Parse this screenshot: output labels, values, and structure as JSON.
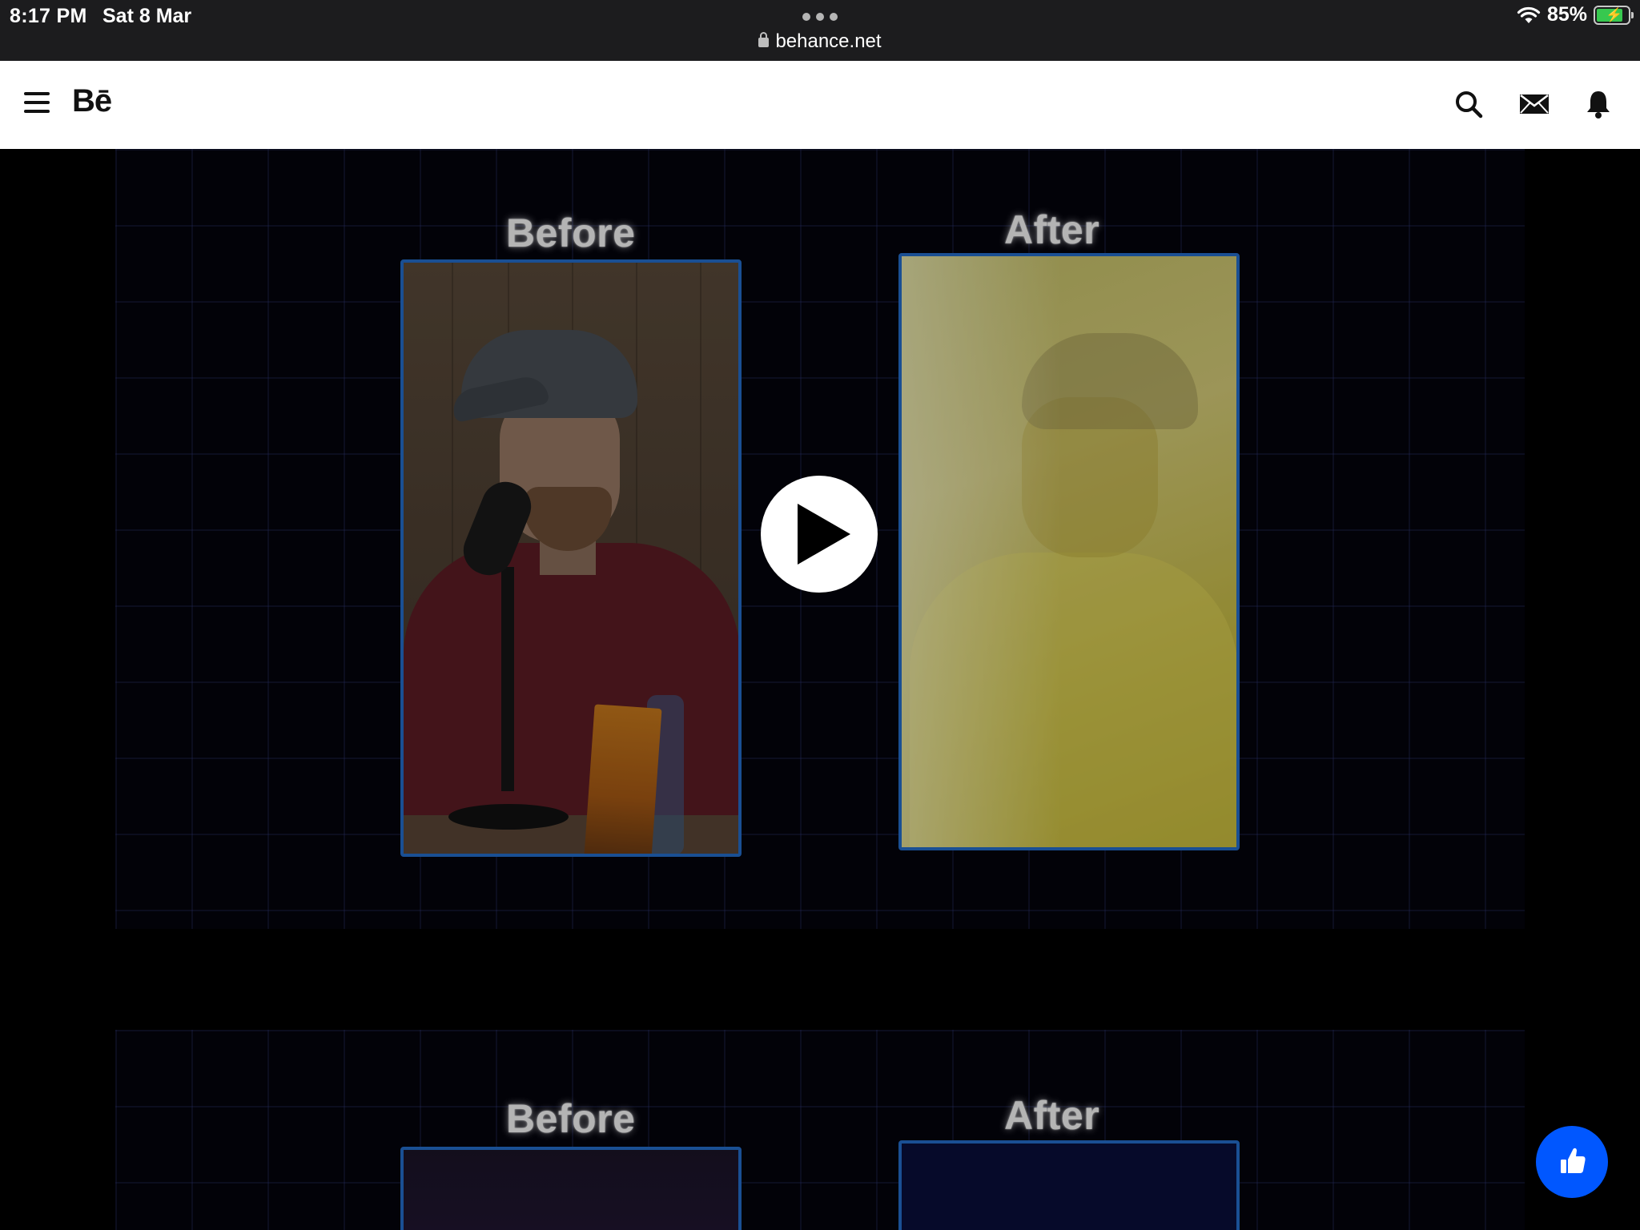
{
  "status_bar": {
    "time": "8:17 PM",
    "date": "Sat 8 Mar",
    "battery_percent_label": "85%",
    "battery_level": 0.85,
    "battery_color": "#37c84f"
  },
  "browser": {
    "url": "behance.net",
    "lock_icon": "lock-icon",
    "tab_overview_icon": "more-dots-icon"
  },
  "header": {
    "logo": "Bē",
    "menu_icon": "hamburger-menu-icon",
    "icons": [
      "search-icon",
      "mail-icon",
      "bell-icon"
    ]
  },
  "content": {
    "sections": [
      {
        "before_label": "Before",
        "after_label": "After"
      },
      {
        "before_label": "Before",
        "after_label": "After"
      }
    ],
    "play_icon": "play-icon",
    "frame_border_color": "#1a4f93"
  },
  "like_button": {
    "icon": "thumbs-up-icon",
    "color": "#0057ff"
  }
}
